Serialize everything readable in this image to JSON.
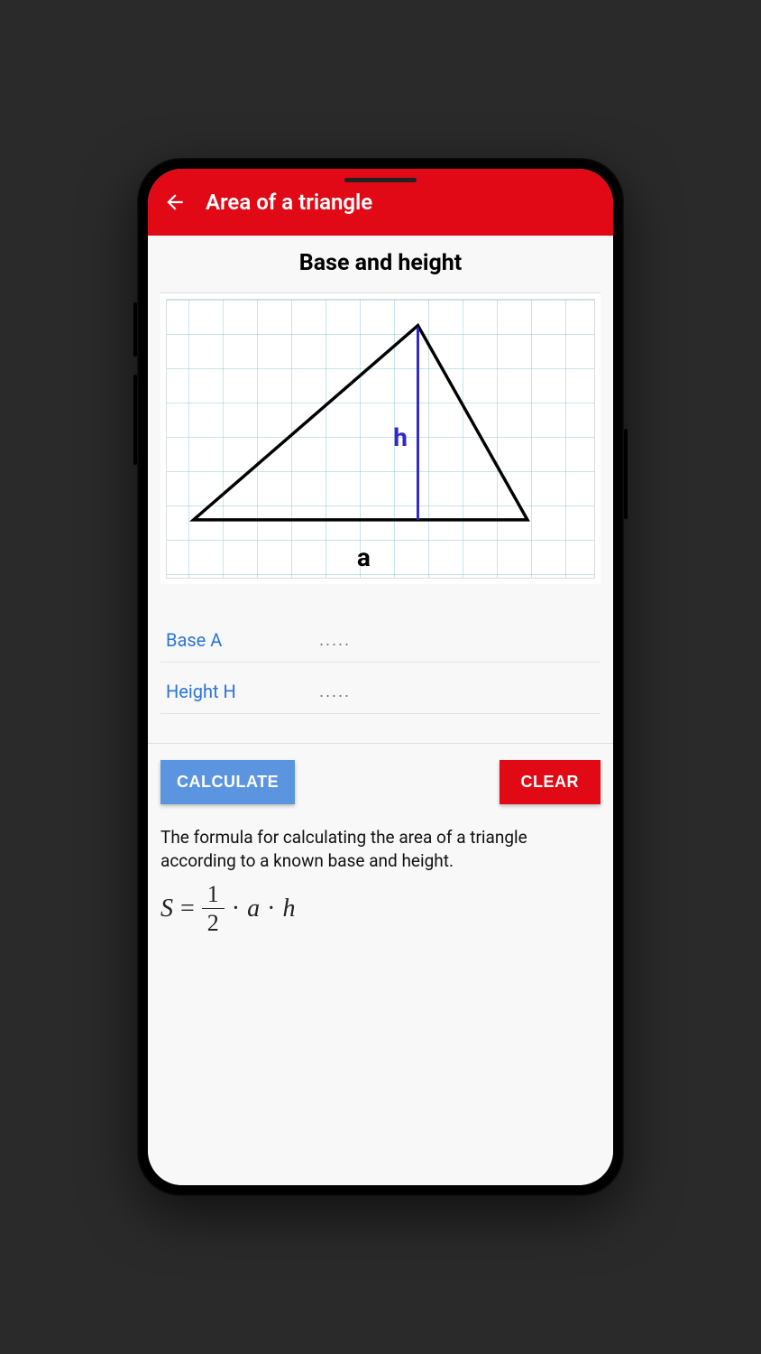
{
  "appBar": {
    "title": "Area of a triangle"
  },
  "section": {
    "title": "Base and height"
  },
  "diagram": {
    "labelH": "h",
    "labelA": "a"
  },
  "inputs": {
    "baseLabel": "Base A",
    "basePlaceholder": ".....",
    "baseValue": "",
    "heightLabel": "Height H",
    "heightPlaceholder": ".....",
    "heightValue": ""
  },
  "buttons": {
    "calculate": "CALCULATE",
    "clear": "CLEAR"
  },
  "description": "The formula for calculating the area of a triangle according to a known base and height.",
  "formula": {
    "S": "S",
    "eq": "=",
    "half_num": "1",
    "half_den": "2",
    "dot1": "·",
    "a": "a",
    "dot2": "·",
    "h": "h"
  }
}
